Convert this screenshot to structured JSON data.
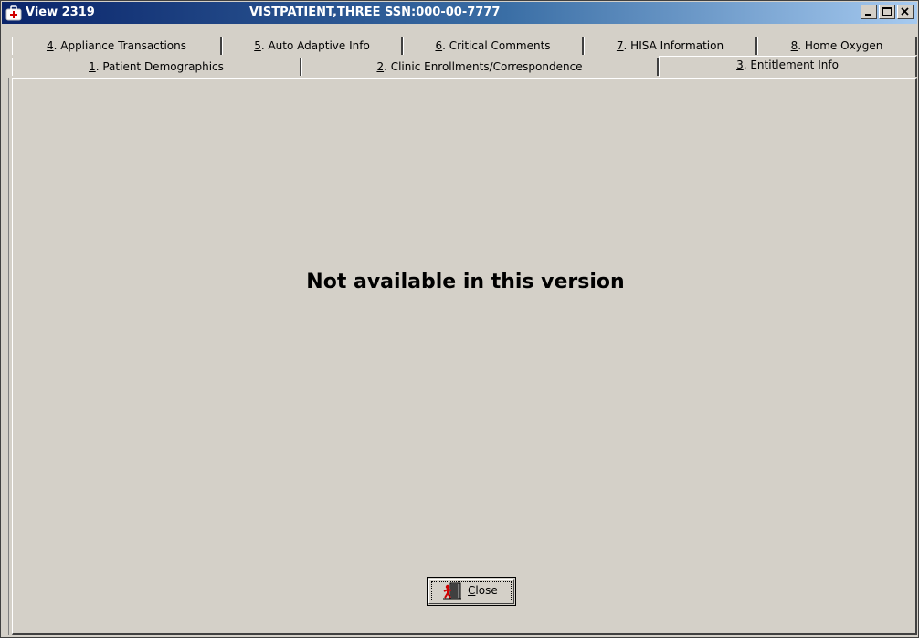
{
  "window": {
    "title": "View 2319",
    "patient": "VISTPATIENT,THREE  SSN:000-00-7777"
  },
  "tabs_back": [
    {
      "key": "4",
      "label": ". Appliance Transactions"
    },
    {
      "key": "5",
      "label": ". Auto Adaptive Info"
    },
    {
      "key": "6",
      "label": ". Critical Comments"
    },
    {
      "key": "7",
      "label": ". HISA Information"
    },
    {
      "key": "8",
      "label": ". Home Oxygen"
    }
  ],
  "tabs_front": [
    {
      "key": "1",
      "label": ". Patient Demographics"
    },
    {
      "key": "2",
      "label": ". Clinic Enrollments/Correspondence"
    },
    {
      "key": "3",
      "label": ". Entitlement Info"
    }
  ],
  "main": {
    "message": "Not available in this version",
    "close_key": "C",
    "close_rest": "lose"
  },
  "icons": {
    "app": "medical-bag-icon",
    "minimize": "minimize-icon",
    "maximize": "maximize-icon",
    "close": "close-icon",
    "close_button": "exit-door-icon"
  }
}
